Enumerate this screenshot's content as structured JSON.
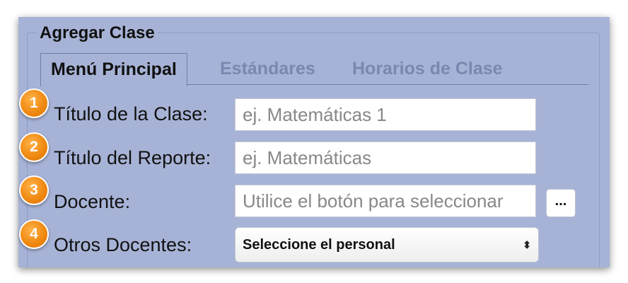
{
  "form": {
    "legend": "Agregar Clase",
    "tabs": [
      {
        "label": "Menú Principal",
        "active": true
      },
      {
        "label": "Estándares",
        "active": false
      },
      {
        "label": "Horarios de Clase",
        "active": false
      }
    ],
    "fields": [
      {
        "number": "1",
        "label": "Título de la Clase:",
        "placeholder": "ej. Matemáticas 1"
      },
      {
        "number": "2",
        "label": "Título del Reporte:",
        "placeholder": "ej. Matemáticas"
      },
      {
        "number": "3",
        "label": "Docente:",
        "placeholder": "Utilice el botón para seleccionar",
        "button_label": "..."
      },
      {
        "number": "4",
        "label": "Otros Docentes:",
        "select_value": "Seleccione el personal",
        "select_arrow": "⬍"
      }
    ]
  },
  "colors": {
    "panel_bg": "#a7b3d6",
    "badge": "#f08a12",
    "tab_inactive": "#7a88b0"
  }
}
